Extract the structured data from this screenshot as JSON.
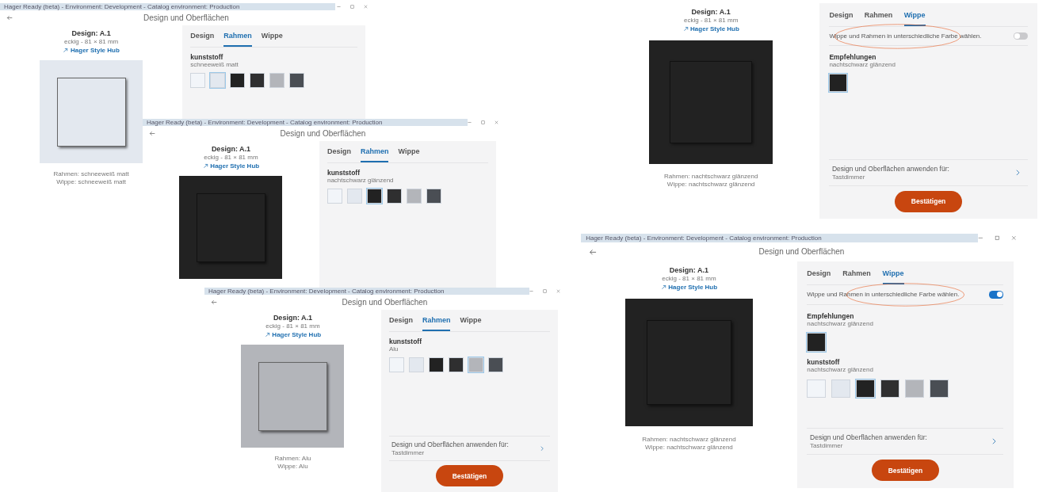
{
  "windows": [
    {
      "title_bar": "Hager Ready (beta) - Environment: Development - Catalog environment: Production",
      "header": "Design und Oberflächen",
      "product": {
        "name": "Design: A.1",
        "dimensions": "eckig - 81 × 81 mm",
        "link": "Hager Style Hub"
      },
      "caption": [
        "Rahmen: schneeweiß matt",
        "Wippe: schneeweiß matt"
      ],
      "tabs": [
        {
          "label": "Design",
          "selected": false
        },
        {
          "label": "Rahmen",
          "selected": true
        },
        {
          "label": "Wippe",
          "selected": false
        }
      ],
      "materials": [
        {
          "title": "kunststoff",
          "subtitle": "schneeweiß matt",
          "swatches": [
            {
              "color": "#f2f5f9",
              "selected": false
            },
            {
              "color": "#e3e8ef",
              "selected": true
            },
            {
              "color": "#222222",
              "selected": false
            },
            {
              "color": "#2f2f30",
              "selected": false
            },
            {
              "color": "#b3b5ba",
              "selected": false
            },
            {
              "color": "#4a4e54",
              "selected": false
            }
          ]
        }
      ]
    },
    {
      "title_bar": "Hager Ready (beta) - Environment: Development - Catalog environment: Production",
      "header": "Design und Oberflächen",
      "product": {
        "name": "Design: A.1",
        "dimensions": "eckig - 81 × 81 mm",
        "link": "Hager Style Hub"
      },
      "tabs": [
        {
          "label": "Design",
          "selected": false
        },
        {
          "label": "Rahmen",
          "selected": true
        },
        {
          "label": "Wippe",
          "selected": false
        }
      ],
      "materials": [
        {
          "title": "kunststoff",
          "subtitle": "nachtschwarz glänzend",
          "swatches": [
            {
              "color": "#f2f5f9",
              "selected": false
            },
            {
              "color": "#e3e8ef",
              "selected": false
            },
            {
              "color": "#222222",
              "selected": true
            },
            {
              "color": "#2f2f30",
              "selected": false
            },
            {
              "color": "#b3b5ba",
              "selected": false
            },
            {
              "color": "#4a4e54",
              "selected": false
            }
          ]
        }
      ]
    },
    {
      "title_bar": "Hager Ready (beta) - Environment: Development - Catalog environment: Production",
      "header": "Design und Oberflächen",
      "product": {
        "name": "Design: A.1",
        "dimensions": "eckig - 81 × 81 mm",
        "link": "Hager Style Hub"
      },
      "caption": [
        "Rahmen: Alu",
        "Wippe: Alu"
      ],
      "tabs": [
        {
          "label": "Design",
          "selected": false
        },
        {
          "label": "Rahmen",
          "selected": true
        },
        {
          "label": "Wippe",
          "selected": false
        }
      ],
      "materials": [
        {
          "title": "kunststoff",
          "subtitle": "Alu",
          "swatches": [
            {
              "color": "#f2f5f9",
              "selected": false
            },
            {
              "color": "#e3e8ef",
              "selected": false
            },
            {
              "color": "#222222",
              "selected": false
            },
            {
              "color": "#2f2f30",
              "selected": false
            },
            {
              "color": "#b3b5ba",
              "selected": true
            },
            {
              "color": "#4a4e54",
              "selected": false
            }
          ]
        }
      ],
      "apply": {
        "title": "Design und Oberflächen anwenden für:",
        "subtitle": "Tastdimmer"
      },
      "confirm_button": "Bestätigen"
    },
    {
      "product": {
        "name": "Design: A.1",
        "dimensions": "eckig - 81 × 81 mm",
        "link": "Hager Style Hub"
      },
      "caption": [
        "Rahmen: nachtschwarz glänzend",
        "Wippe: nachtschwarz glänzend"
      ],
      "tabs": [
        {
          "label": "Design",
          "selected": false
        },
        {
          "label": "Rahmen",
          "selected": false
        },
        {
          "label": "Wippe",
          "selected": true
        }
      ],
      "toggle": {
        "label": "Wippe und Rahmen in unterschiedliche Farbe wählen.",
        "on": false
      },
      "recommendations": {
        "title": "Empfehlungen",
        "subtitle": "nachtschwarz glänzend",
        "swatches": [
          {
            "color": "#222222",
            "selected": true
          }
        ]
      },
      "apply": {
        "title": "Design und Oberflächen anwenden für:",
        "subtitle": "Tastdimmer"
      },
      "confirm_button": "Bestätigen"
    },
    {
      "title_bar": "Hager Ready (beta) - Environment: Development - Catalog environment: Production",
      "header": "Design und Oberflächen",
      "product": {
        "name": "Design: A.1",
        "dimensions": "eckig - 81 × 81 mm",
        "link": "Hager Style Hub"
      },
      "caption": [
        "Rahmen: nachtschwarz glänzend",
        "Wippe: nachtschwarz glänzend"
      ],
      "tabs": [
        {
          "label": "Design",
          "selected": false
        },
        {
          "label": "Rahmen",
          "selected": false
        },
        {
          "label": "Wippe",
          "selected": true
        }
      ],
      "toggle": {
        "label": "Wippe und Rahmen in unterschiedliche Farbe wählen.",
        "on": true
      },
      "recommendations": {
        "title": "Empfehlungen",
        "subtitle": "nachtschwarz glänzend",
        "swatches": [
          {
            "color": "#222222",
            "selected": true
          }
        ]
      },
      "materials": [
        {
          "title": "kunststoff",
          "subtitle": "nachtschwarz glänzend",
          "swatches": [
            {
              "color": "#f2f5f9",
              "selected": false
            },
            {
              "color": "#e3e8ef",
              "selected": false
            },
            {
              "color": "#222222",
              "selected": true
            },
            {
              "color": "#2f2f30",
              "selected": false
            },
            {
              "color": "#b3b5ba",
              "selected": false
            },
            {
              "color": "#4a4e54",
              "selected": false
            }
          ]
        }
      ],
      "apply": {
        "title": "Design und Oberflächen anwenden für:",
        "subtitle": "Tastdimmer"
      },
      "confirm_button": "Bestätigen"
    }
  ]
}
